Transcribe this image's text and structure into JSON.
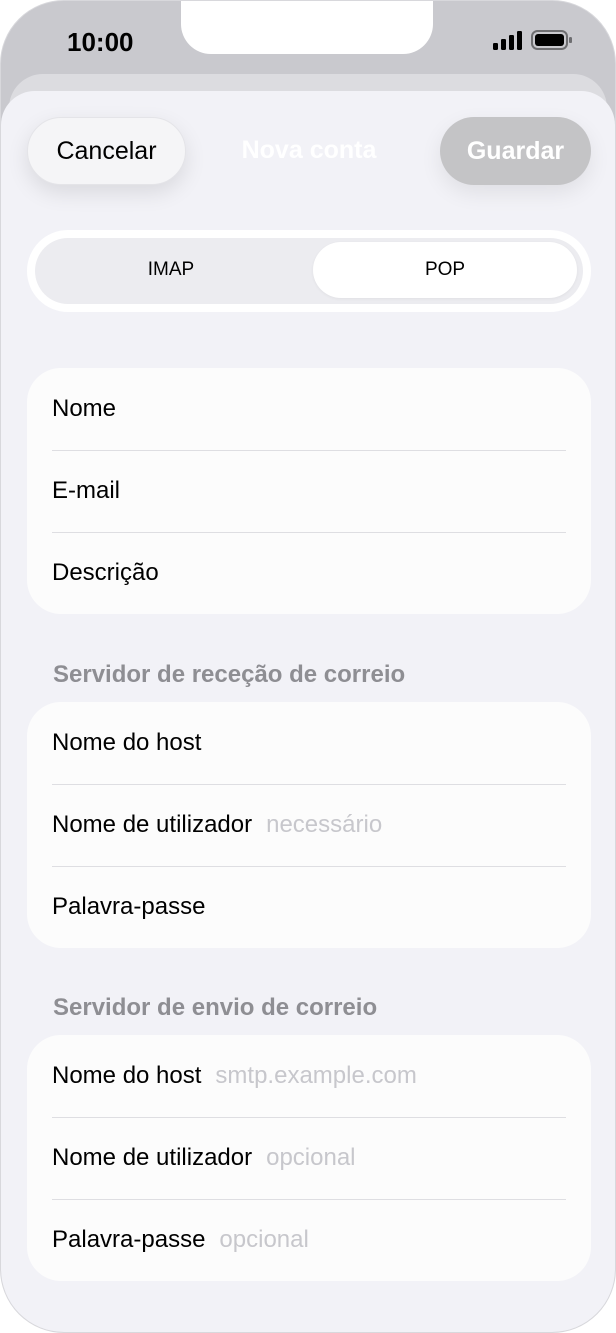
{
  "status_bar": {
    "time": "10:00",
    "icons": [
      "signal-icon",
      "battery-icon"
    ]
  },
  "nav": {
    "cancel_label": "Cancelar",
    "title": "Nova conta",
    "save_label": "Guardar"
  },
  "segmented": {
    "options": [
      "IMAP",
      "POP"
    ],
    "selected": "POP"
  },
  "account_group": {
    "rows": [
      {
        "label": "Nome",
        "placeholder": ""
      },
      {
        "label": "E-mail",
        "placeholder": ""
      },
      {
        "label": "Descrição",
        "placeholder": ""
      }
    ]
  },
  "incoming": {
    "header": "Servidor de receção de correio",
    "rows": [
      {
        "label": "Nome do host",
        "placeholder": ""
      },
      {
        "label": "Nome de utilizador",
        "placeholder": "necessário"
      },
      {
        "label": "Palavra-passe",
        "placeholder": ""
      }
    ]
  },
  "outgoing": {
    "header": "Servidor de envio de correio",
    "rows": [
      {
        "label": "Nome do host",
        "placeholder": "smtp.example.com"
      },
      {
        "label": "Nome de utilizador",
        "placeholder": "opcional"
      },
      {
        "label": "Palavra-passe",
        "placeholder": "opcional"
      }
    ]
  },
  "colors": {
    "background": "#f2f2f7",
    "card": "#fcfcfc",
    "section_header": "#8e8e93",
    "placeholder": "#c7c7cc",
    "save_disabled": "#c4c4c6"
  }
}
